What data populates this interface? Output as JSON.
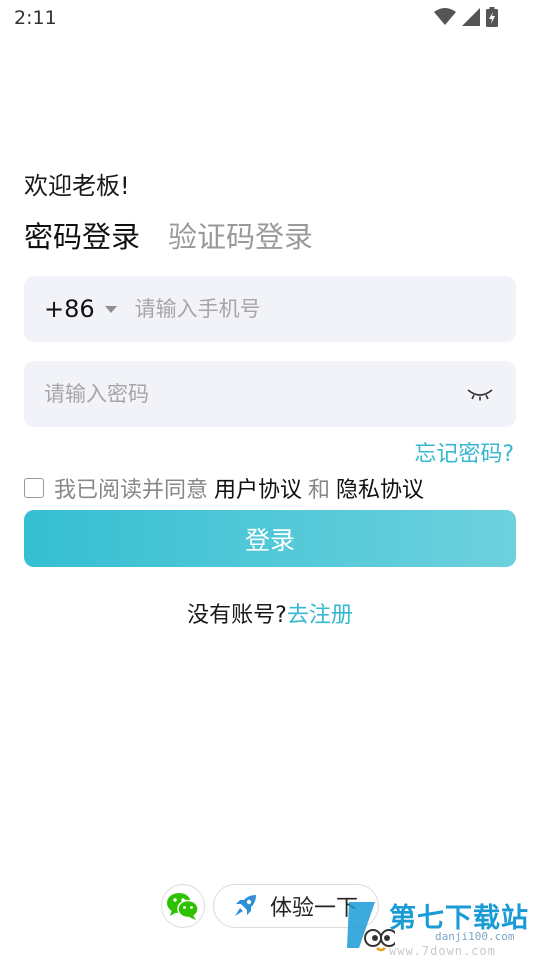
{
  "status_bar": {
    "time": "2:11",
    "icons": [
      "wifi-icon",
      "cellular-signal-icon",
      "battery-charging-icon"
    ]
  },
  "welcome": "欢迎老板!",
  "tabs": [
    {
      "label": "密码登录",
      "active": true
    },
    {
      "label": "验证码登录",
      "active": false
    }
  ],
  "phone_field": {
    "country_code": "+86",
    "placeholder": "请输入手机号",
    "value": ""
  },
  "password_field": {
    "placeholder": "请输入密码",
    "value": ""
  },
  "forgot_password": "忘记密码?",
  "agreement": {
    "checked": false,
    "prefix": "我已阅读并同意",
    "user_agreement": "用户协议",
    "and": "和",
    "privacy_policy": "隐私协议"
  },
  "login_button": "登录",
  "register": {
    "question": "没有账号?",
    "link": "去注册"
  },
  "bottom": {
    "wechat_icon": "wechat-icon",
    "try_label": "体验一下"
  },
  "watermark": {
    "main": "第七下载站",
    "sub": "danji100.com",
    "url": "www.7down.com"
  },
  "colors": {
    "accent": "#36b8cf",
    "button_start": "#35bfd2",
    "button_end": "#6dd1dd",
    "field_bg": "#f1f3f8",
    "wechat": "#2dc100",
    "rocket": "#2f8fd8"
  }
}
